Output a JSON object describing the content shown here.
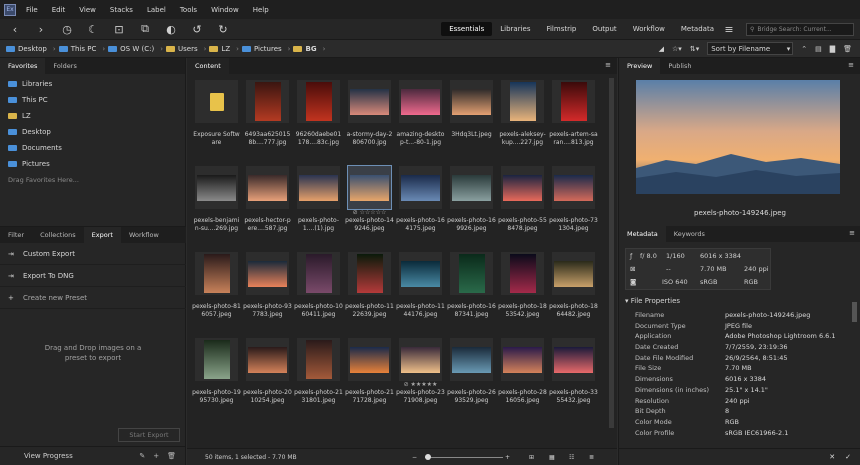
{
  "app": {
    "logo_text": "Ex"
  },
  "menu": [
    "File",
    "Edit",
    "View",
    "Stacks",
    "Label",
    "Tools",
    "Window",
    "Help"
  ],
  "workspaces": {
    "active": "Essentials",
    "items": [
      "Essentials",
      "Libraries",
      "Filmstrip",
      "Output",
      "Workflow",
      "Metadata"
    ]
  },
  "search": {
    "placeholder": "Bridge Search: Current..."
  },
  "path": [
    "Desktop",
    "This PC",
    "OS W (C:)",
    "Users",
    "LZ",
    "Pictures",
    "BG"
  ],
  "sort": {
    "label": "Sort by Filename"
  },
  "left": {
    "tabs": [
      "Favorites",
      "Folders"
    ],
    "favorites": [
      "Libraries",
      "This PC",
      "LZ",
      "Desktop",
      "Documents",
      "Pictures"
    ],
    "drag_hint": "Drag Favorites Here...",
    "lower_tabs": [
      "Filter",
      "Collections",
      "Export",
      "Workflow"
    ],
    "export_items": [
      "Custom Export",
      "Export To DNG",
      "Create new Preset"
    ],
    "drop_msg_1": "Drag and Drop images on a",
    "drop_msg_2": "preset to export",
    "start_export": "Start Export",
    "view_progress": "View Progress"
  },
  "content": {
    "tab": "Content",
    "status": "50 items, 1 selected - 7.70 MB",
    "items": [
      {
        "name": "Exposure Software",
        "kind": "folder"
      },
      {
        "name": "6493aa6250158b....777.jpg",
        "c1": "#3a1510",
        "c2": "#b43a22",
        "portrait": true
      },
      {
        "name": "96260daebe01178....83c.jpg",
        "c1": "#4a0c0a",
        "c2": "#c2331f",
        "portrait": true
      },
      {
        "name": "a-stormy-day-2806700.jpg",
        "c1": "#243246",
        "c2": "#d98a7a"
      },
      {
        "name": "amazing-desktop-t...-80-1.jpg",
        "c1": "#4c2a3e",
        "c2": "#f06a8e"
      },
      {
        "name": "3Hdq3Lt.jpeg",
        "c1": "#2e2a2a",
        "c2": "#e4a072"
      },
      {
        "name": "pexels-aleksey-kup....227.jpg",
        "c1": "#16355a",
        "c2": "#e9b47a",
        "portrait": true
      },
      {
        "name": "pexels-artem-saran....813.jpg",
        "c1": "#3a0a0a",
        "c2": "#d42a2a",
        "portrait": true
      },
      {
        "name": "pexels-benjamin-su....269.jpg",
        "c1": "#1a1a1a",
        "c2": "#8a8a8a"
      },
      {
        "name": "pexels-hector-pere....587.jpg",
        "c1": "#3a2a2a",
        "c2": "#e8a07a"
      },
      {
        "name": "pexels-photo-1....(1).jpg",
        "c1": "#2a3450",
        "c2": "#e6a06a"
      },
      {
        "name": "pexels-photo-149246.jpeg",
        "c1": "#3a5070",
        "c2": "#e8a66a",
        "selected": true
      },
      {
        "name": "pexels-photo-164175.jpeg",
        "c1": "#1a2a4a",
        "c2": "#6a8ab4"
      },
      {
        "name": "pexels-photo-169926.jpeg",
        "c1": "#2a3a3a",
        "c2": "#8aa0a0"
      },
      {
        "name": "pexels-photo-558478.jpeg",
        "c1": "#1a2440",
        "c2": "#e86a5a"
      },
      {
        "name": "pexels-photo-731304.jpeg",
        "c1": "#1a2a4a",
        "c2": "#d46a5a"
      },
      {
        "name": "pexels-photo-816057.jpeg",
        "c1": "#2a1a1a",
        "c2": "#c8825a",
        "portrait": true
      },
      {
        "name": "pexels-photo-937783.jpeg",
        "c1": "#1a2a3a",
        "c2": "#e8825a"
      },
      {
        "name": "pexels-photo-1060411.jpeg",
        "c1": "#2a1a2a",
        "c2": "#7a4a6a",
        "portrait": true
      },
      {
        "name": "pexels-photo-1122639.jpeg",
        "c1": "#0a1a0a",
        "c2": "#b43a3a",
        "portrait": true
      },
      {
        "name": "pexels-photo-1144176.jpeg",
        "c1": "#0a2a3a",
        "c2": "#4a8aa4"
      },
      {
        "name": "pexels-photo-1687341.jpeg",
        "c1": "#0a2a1a",
        "c2": "#2a6a4a",
        "portrait": true
      },
      {
        "name": "pexels-photo-1853542.jpeg",
        "c1": "#0a0a1a",
        "c2": "#a42a4a",
        "portrait": true
      },
      {
        "name": "pexels-photo-1864482.jpeg",
        "c1": "#2a2a1a",
        "c2": "#c8a06a"
      },
      {
        "name": "pexels-photo-1995730.jpeg",
        "c1": "#1a2a1a",
        "c2": "#8aa48a",
        "portrait": true
      },
      {
        "name": "pexels-photo-2010254.jpeg",
        "c1": "#2a1a1a",
        "c2": "#d4825a"
      },
      {
        "name": "pexels-photo-2131801.jpeg",
        "c1": "#2a1a1a",
        "c2": "#a45a3a",
        "portrait": true
      },
      {
        "name": "pexels-photo-2171728.jpeg",
        "c1": "#1a2a4a",
        "c2": "#e8823a"
      },
      {
        "name": "pexels-photo-2371908.jpeg",
        "c1": "#3a2a3a",
        "c2": "#f0c08a",
        "rating": "⊘ ★★★★★"
      },
      {
        "name": "pexels-photo-2693529.jpeg",
        "c1": "#1a2a3a",
        "c2": "#6a9ab4"
      },
      {
        "name": "pexels-photo-2816056.jpeg",
        "c1": "#2a1a4a",
        "c2": "#d4825a"
      },
      {
        "name": "pexels-photo-3355432.jpeg",
        "c1": "#1a1a3a",
        "c2": "#e86a6a"
      }
    ]
  },
  "selected_rating": "⊘ ☆☆☆☆☆",
  "right": {
    "tabs": [
      "Preview",
      "Publish"
    ],
    "preview_name": "pexels-photo-149246.jpeg",
    "md_tabs": [
      "Metadata",
      "Keywords"
    ],
    "exif": {
      "aperture": "f/ 8.0",
      "shutter": "1/160",
      "flash": "--",
      "iso": "ISO 640",
      "dims": "6016 x 3384",
      "size": "7.70 MB",
      "ppi": "240 ppi",
      "cs": "sRGB",
      "mode": "RGB"
    },
    "file_props_title": "File Properties",
    "props": [
      [
        "Filename",
        "pexels-photo-149246.jpeg"
      ],
      [
        "Document Type",
        "JPEG file"
      ],
      [
        "Application",
        "Adobe Photoshop Lightroom 6.6.1"
      ],
      [
        "Date Created",
        "7/7/2559, 23:19:36"
      ],
      [
        "Date File Modified",
        "26/9/2564, 8:51:45"
      ],
      [
        "File Size",
        "7.70 MB"
      ],
      [
        "Dimensions",
        "6016 x 3384"
      ],
      [
        "Dimensions (in inches)",
        "25.1\" x 14.1\""
      ],
      [
        "Resolution",
        "240 ppi"
      ],
      [
        "Bit Depth",
        "8"
      ],
      [
        "Color Mode",
        "RGB"
      ],
      [
        "Color Profile",
        "sRGB IEC61966-2.1"
      ]
    ]
  }
}
